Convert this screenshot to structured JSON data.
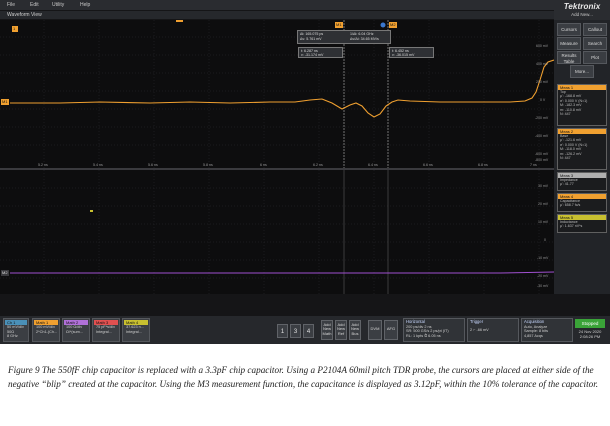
{
  "menubar": {
    "items": [
      "File",
      "Edit",
      "Utility",
      "Help"
    ],
    "brand": "Tektronix",
    "add_new": "Add New..."
  },
  "waveform_view": {
    "title": "Waveform View",
    "markers": {
      "m1": "M1",
      "m2": "M2",
      "c1": "1"
    },
    "readout_delta": [
      "Δt: 165.075 ps",
      "1/Δt: 6.04 GHz",
      "Δv: 5.761 mV",
      "Δv/Δt: 34.65 MV/s"
    ],
    "readout_a": [
      "t: 6.287 ns",
      "v: -31.174 mV"
    ],
    "readout_b": [
      "t: 6.452 ns",
      "v: -36.015 mV"
    ],
    "right_axis_top": [
      "600 mV",
      "400 mV",
      "200 mV",
      "0 V",
      "-200 mV",
      "-400 mV",
      "-600 mV",
      "-800 mV"
    ],
    "right_axis_bottom": [
      "30 mV",
      "20 mV",
      "10 mV",
      "0",
      "-10 mV",
      "-20 mV",
      "-30 mV",
      "-40 mV"
    ],
    "time_labels": [
      "5.2 ns",
      "5.4 ns",
      "5.6 ns",
      "5.8 ns",
      "6 ns",
      "6.2 ns",
      "6.4 ns",
      "6.6 ns",
      "6.8 ns",
      "7 ns"
    ],
    "ch_label_top": "M1",
    "ch_label_bottom": "M2",
    "colors": {
      "trace_orange": "#f0a030",
      "trace_purple": "#a050d0",
      "cursor": "#b8b8b8"
    }
  },
  "right_panel": {
    "buttons": [
      "Cursors",
      "Callout",
      "Measure",
      "Search",
      "Results Table",
      "Plot",
      "More..."
    ],
    "meas": [
      {
        "head": "Meas 1",
        "lines": [
          "Top",
          "μ': -168.8 mV",
          "σ': 0.000 V (N=1)",
          "M: -182.3 mV",
          "m: -110.8 mV",
          "N: 447"
        ]
      },
      {
        "head": "Meas 2",
        "lines": [
          "Base",
          "μ': -121.6 mV",
          "σ': 0.000 V (N=1)",
          "M: -118.0 mV",
          "m: -126.2 mV",
          "N: 447"
        ]
      },
      {
        "head": "Meas 3",
        "lines": [
          "Impedance",
          "μ': 41.77"
        ]
      },
      {
        "head": "Meas 4",
        "lines": [
          "Capacitance",
          "μ': 658.7 fc/s"
        ]
      },
      {
        "head": "Meas 5",
        "lines": [
          "Inductance",
          "μ': 1.637 nV*s"
        ]
      }
    ]
  },
  "bottombar": {
    "ch1": {
      "head": "Ch 1",
      "lines": [
        "50 mV/div",
        "50Ω",
        "8 GHz"
      ]
    },
    "math1": {
      "head": "Math 1",
      "lines": [
        "100 mV/div",
        "2*Ch1-(Ch..."
      ]
    },
    "math2": {
      "head": "Math 2",
      "lines": [
        "100 Ω/div",
        "Ω/*(sum..."
      ]
    },
    "math3": {
      "head": "Math 3",
      "lines": [
        "75 pF*s/div",
        "Integral..."
      ]
    },
    "math4": {
      "head": "Math 4",
      "lines": [
        "37.623 n...",
        "Integral..."
      ]
    },
    "numbers": [
      "1",
      "3",
      "4"
    ],
    "add_buttons": [
      "Add New Math",
      "Add New Ref",
      "Add New Bus"
    ],
    "dvm": "DVM",
    "afg": "AFG",
    "horizontal": {
      "head": "Horizontal",
      "lines": [
        "200 ps/div   2 ns",
        "SR: 500 GS/s   2 ps/pt (IT)",
        "RL: 1 kpts   ⏱ 6.05 ns"
      ]
    },
    "trigger": {
      "head": "Trigger",
      "lines": [
        "2  ⌐  -66 mV"
      ]
    },
    "acquisition": {
      "head": "Acquisition",
      "lines": [
        "Auto,      Analyze",
        "Sample: 8 bits",
        "4,857 Acqs"
      ]
    },
    "status": "Stopped",
    "datetime": [
      "24 Nov 2020",
      "2:08:26 PM"
    ]
  },
  "caption": "Figure 9 The 550fF chip capacitor is replaced with a 3.3pF chip capacitor.  Using a P2104A 60mil pitch TDR probe, the cursors are placed at either side of the negative “blip” created at the capacitor.  Using the M3 measurement function, the capacitance is displayed as 3.12pF, within the 10% tolerance of the capacitor."
}
